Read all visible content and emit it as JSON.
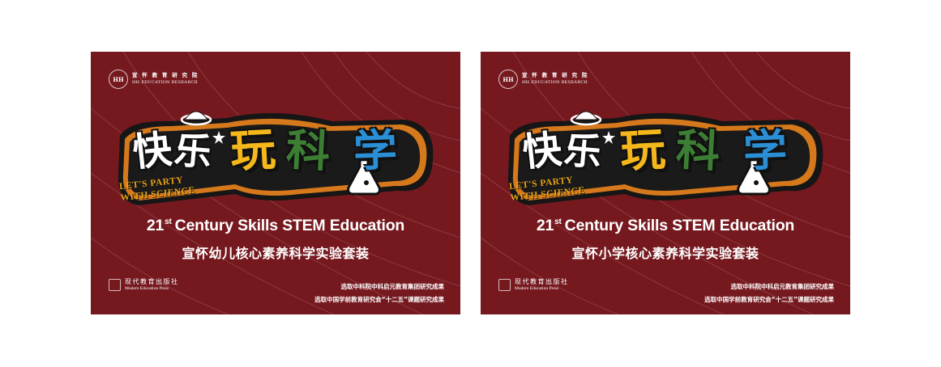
{
  "colors": {
    "background": "#76191f",
    "white": "#ffffff",
    "yellow": "#f5b81b",
    "green": "#3c7e34",
    "blue": "#2b8fd6"
  },
  "cards": [
    {
      "org_cn": "宣 怀 教 育 研 究 院",
      "org_en": "HH EDUCATION RESEARCH",
      "logo_chars": [
        "快",
        "乐",
        "玩",
        "科",
        "学"
      ],
      "tagline_1": "LET'S PARTY",
      "tagline_2": "WITH SCIENCE",
      "title_num": "21",
      "title_sup": "st",
      "title_rest": "Century Skills STEM Education",
      "subtitle_cn": "宣怀幼儿核心素养科学实验套装",
      "press_cn": "现代教育出版社",
      "press_en": "Modern Education Press",
      "note_1": "选取中科院中科启元教育集团研究成果",
      "note_2": "选取中国学前教育研究会“十二五”课题研究成果"
    },
    {
      "org_cn": "宣 怀 教 育 研 究 院",
      "org_en": "HH EDUCATION RESEARCH",
      "logo_chars": [
        "快",
        "乐",
        "玩",
        "科",
        "学"
      ],
      "tagline_1": "LET'S PARTY",
      "tagline_2": "WITH SCIENCE",
      "title_num": "21",
      "title_sup": "st",
      "title_rest": "Century Skills STEM Education",
      "subtitle_cn": "宣怀小学核心素养科学实验套装",
      "press_cn": "现代教育出版社",
      "press_en": "Modern Education Press",
      "note_1": "选取中科院中科启元教育集团研究成果",
      "note_2": "选取中国学前教育研究会“十二五”课题研究成果"
    }
  ]
}
